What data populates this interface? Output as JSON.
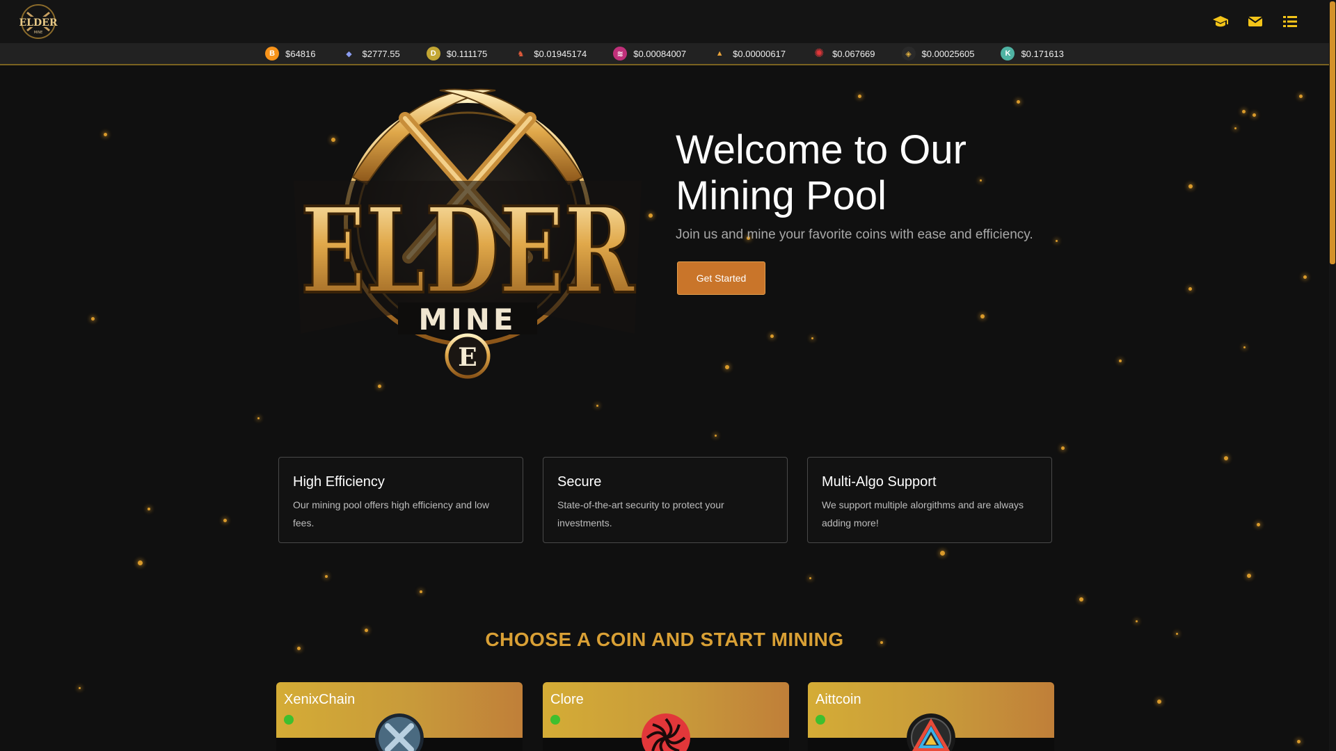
{
  "header": {
    "nav_icons": [
      "graduation-cap-icon",
      "envelope-icon",
      "list-icon"
    ],
    "accent_color": "#f3c419"
  },
  "ticker": [
    {
      "icon": "bitcoin-icon",
      "symbol": "B",
      "color": "#f7931a",
      "price": "$64816"
    },
    {
      "icon": "ethereum-icon",
      "symbol": "◆",
      "color": "#627eea",
      "price": "$2777.55"
    },
    {
      "icon": "dogecoin-icon",
      "symbol": "D",
      "color": "#c2a633",
      "price": "$0.111175"
    },
    {
      "icon": "coin-icon",
      "symbol": "♞",
      "color": "#c4402f",
      "price": "$0.01945174"
    },
    {
      "icon": "coin-icon",
      "symbol": "≋",
      "color": "#c0307a",
      "price": "$0.00084007"
    },
    {
      "icon": "coin-icon",
      "symbol": "▲",
      "color": "#e8a23a",
      "price": "$0.00000617"
    },
    {
      "icon": "clore-icon",
      "symbol": "✺",
      "color": "#e2373a",
      "price": "$0.067669"
    },
    {
      "icon": "coin-icon",
      "symbol": "◈",
      "color": "#2a2a2a",
      "price": "$0.00025605"
    },
    {
      "icon": "coin-icon",
      "symbol": "K",
      "color": "#4fb3a3",
      "price": "$0.171613"
    }
  ],
  "hero": {
    "title_line1": "Welcome to Our",
    "title_line2": "Mining Pool",
    "subtitle": "Join us and mine your favorite coins with ease and efficiency.",
    "cta_label": "Get Started"
  },
  "features": [
    {
      "title": "High Efficiency",
      "text": "Our mining pool offers high efficiency and low fees."
    },
    {
      "title": "Secure",
      "text": "State-of-the-art security to protect your investments."
    },
    {
      "title": "Multi-Algo Support",
      "text": "We support multiple alorgithms and are always adding more!"
    }
  ],
  "coins_section": {
    "title": "CHOOSE A COIN AND START MINING",
    "coins": [
      {
        "name": "XenixChain",
        "status": "online",
        "logo": "xenixchain-logo-icon"
      },
      {
        "name": "Clore",
        "status": "online",
        "logo": "clore-logo-icon"
      },
      {
        "name": "Aittcoin",
        "status": "online",
        "logo": "aittcoin-logo-icon"
      }
    ]
  },
  "colors": {
    "background": "#101010",
    "gold": "#d9a035",
    "button": "#c9752a",
    "status_online": "#3fbf2e"
  }
}
